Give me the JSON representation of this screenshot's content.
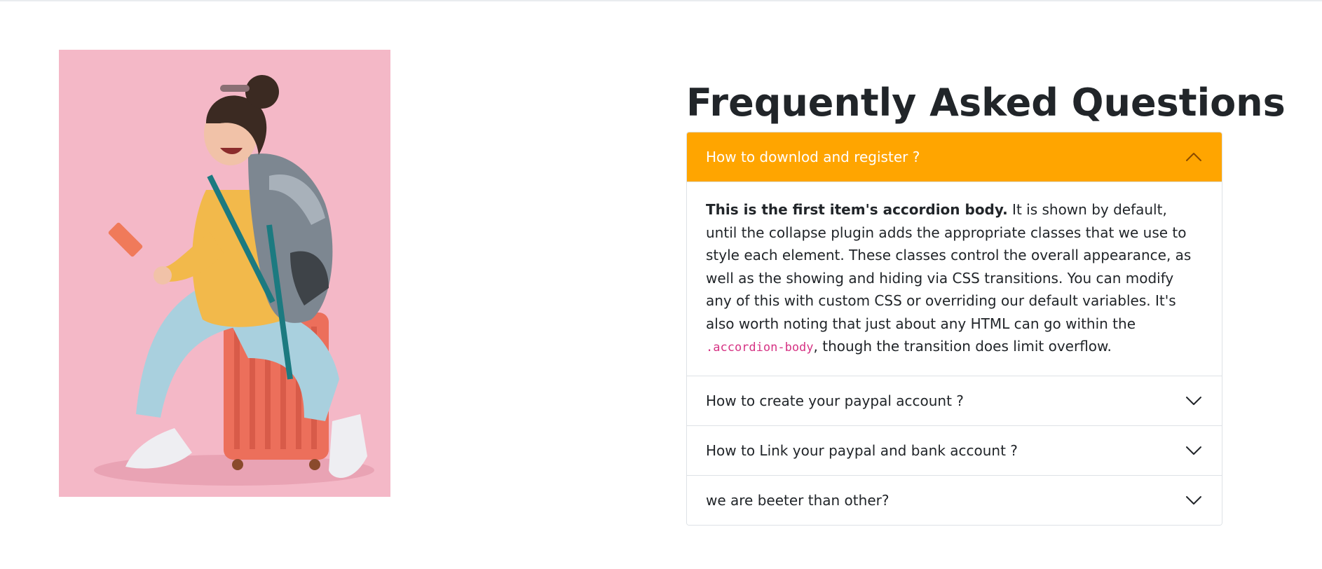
{
  "photo": {
    "alt": "Traveler with backpack sitting on suitcase",
    "background_color": "#f4b8c7"
  },
  "faq": {
    "title": "Frequently Asked Questions",
    "accent_color": "#ffa500",
    "items": [
      {
        "question": "How to downlod and register ?",
        "expanded": true,
        "icon": "chevron-up-icon",
        "body": {
          "lead": "This is the first item's accordion body.",
          "text_before_code": " It is shown by default, until the collapse plugin adds the appropriate classes that we use to style each element. These classes control the overall appearance, as well as the showing and hiding via CSS transitions. You can modify any of this with custom CSS or overriding our default variables. It's also worth noting that just about any HTML can go within the ",
          "code": ".accordion-body",
          "text_after_code": ", though the transition does limit overflow."
        }
      },
      {
        "question": "How to create your paypal account ?",
        "expanded": false,
        "icon": "chevron-down-icon"
      },
      {
        "question": "How to Link your paypal and bank account ?",
        "expanded": false,
        "icon": "chevron-down-icon"
      },
      {
        "question": "we are beeter than other?",
        "expanded": false,
        "icon": "chevron-down-icon"
      }
    ]
  }
}
